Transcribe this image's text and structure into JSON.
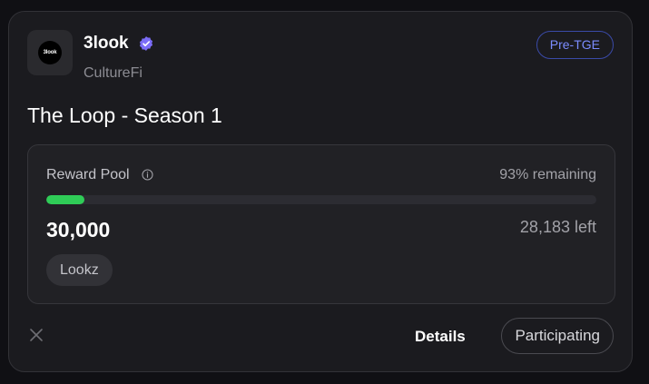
{
  "project": {
    "logo_text": "3look",
    "name": "3look",
    "category": "CultureFi",
    "stage_badge": "Pre-TGE",
    "verified_icon": "verified-badge-icon",
    "accent_color": "#7b8cff"
  },
  "campaign": {
    "title": "The Loop - Season 1"
  },
  "reward_pool": {
    "label": "Reward Pool",
    "info_icon": "info-icon",
    "remaining_text": "93% remaining",
    "progress_fraction": 0.07,
    "progress_color": "#2fcc57",
    "amount": "30,000",
    "left_text": "28,183 left",
    "token": "Lookz"
  },
  "footer": {
    "social_icon": "x-icon",
    "details_label": "Details",
    "participating_label": "Participating"
  }
}
